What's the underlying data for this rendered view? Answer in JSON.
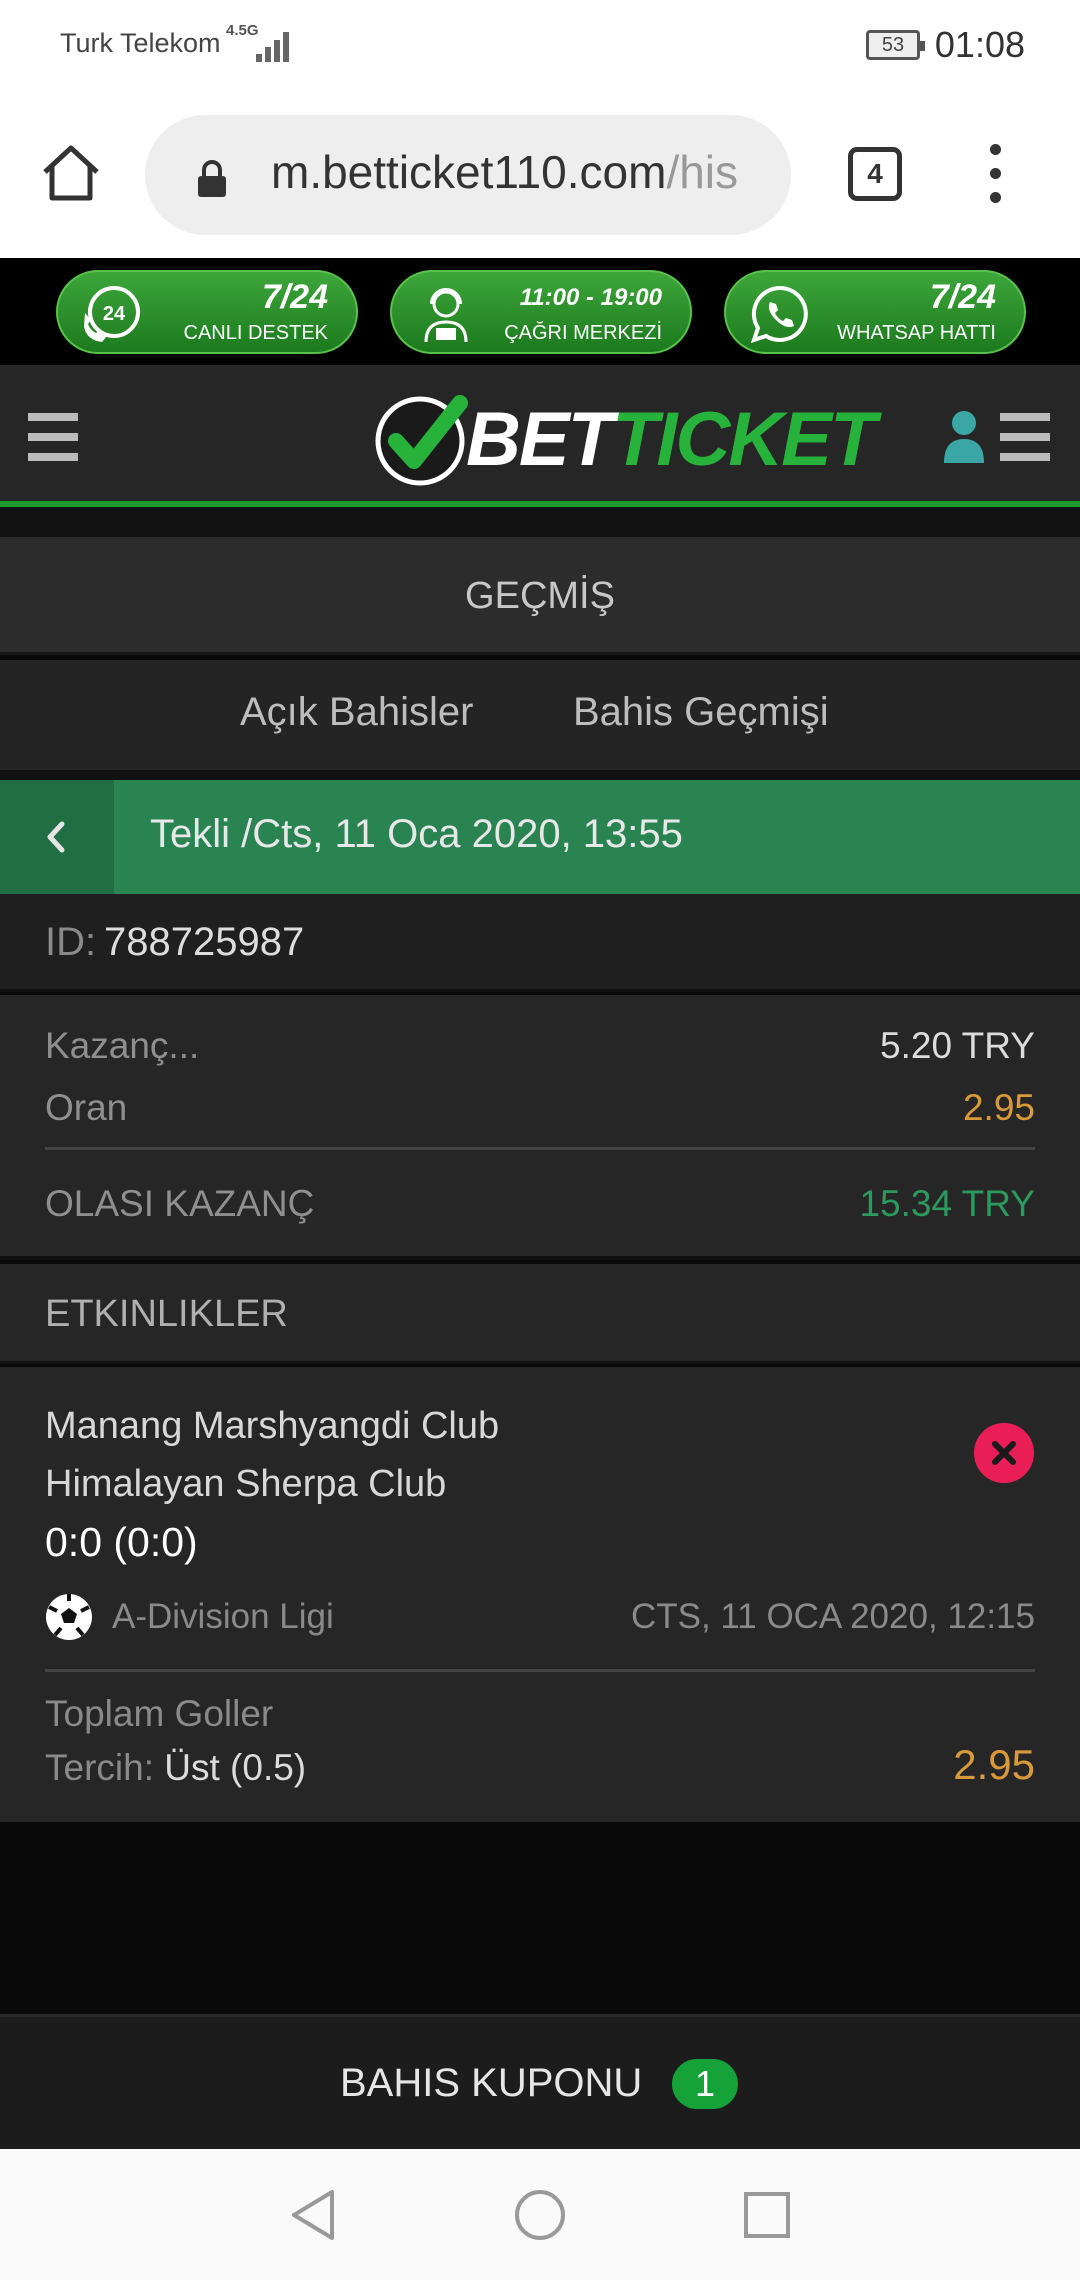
{
  "status_bar": {
    "carrier": "Turk Telekom",
    "network": "4.5G",
    "battery": "53",
    "time": "01:08"
  },
  "browser": {
    "url_main": "m.betticket110.com",
    "url_rest": "/his",
    "tab_count": "4"
  },
  "contact": [
    {
      "big": "7/24",
      "sub": "CANLI DESTEK",
      "icon": "phone-24-icon"
    },
    {
      "big": "11:00 - 19:00",
      "sub": "ÇAĞRI MERKEZİ",
      "icon": "call-center-agent-icon"
    },
    {
      "big": "7/24",
      "sub": "WHATSAP HATTI",
      "icon": "whatsapp-icon"
    }
  ],
  "header": {
    "logo_white": "BET",
    "logo_green": "TICKET"
  },
  "page": {
    "title": "GEÇMİŞ",
    "tabs": [
      "Açık Bahisler",
      "Bahis Geçmişi"
    ]
  },
  "bet": {
    "title": "Tekli /Cts, 11 Oca 2020, 13:55",
    "id_label": "ID:",
    "id": "788725987",
    "stake_label": "Kazanç...",
    "stake": "5.20 TRY",
    "odds_label": "Oran",
    "odds": "2.95",
    "potential_label": "OLASI KAZANÇ",
    "potential": "15.34 TRY"
  },
  "events": {
    "heading": "ETKINLIKLER",
    "items": [
      {
        "home": "Manang Marshyangdi Club",
        "away": "Himalayan Sherpa Club",
        "score": "0:0 (0:0)",
        "league": "A-Division Ligi",
        "date": "CTS, 11 OCA 2020, 12:15",
        "market": "Toplam Goller",
        "pick_label": "Tercih:",
        "pick": "Üst (0.5)",
        "odds": "2.95",
        "status": "lost"
      }
    ]
  },
  "coupon": {
    "label": "BAHIS KUPONU",
    "count": "1"
  },
  "colors": {
    "brand_green": "#27b33b",
    "header_green": "#2a8451",
    "odds": "#d99a3b",
    "win": "#2c9a5e",
    "lost": "#e91e57"
  }
}
